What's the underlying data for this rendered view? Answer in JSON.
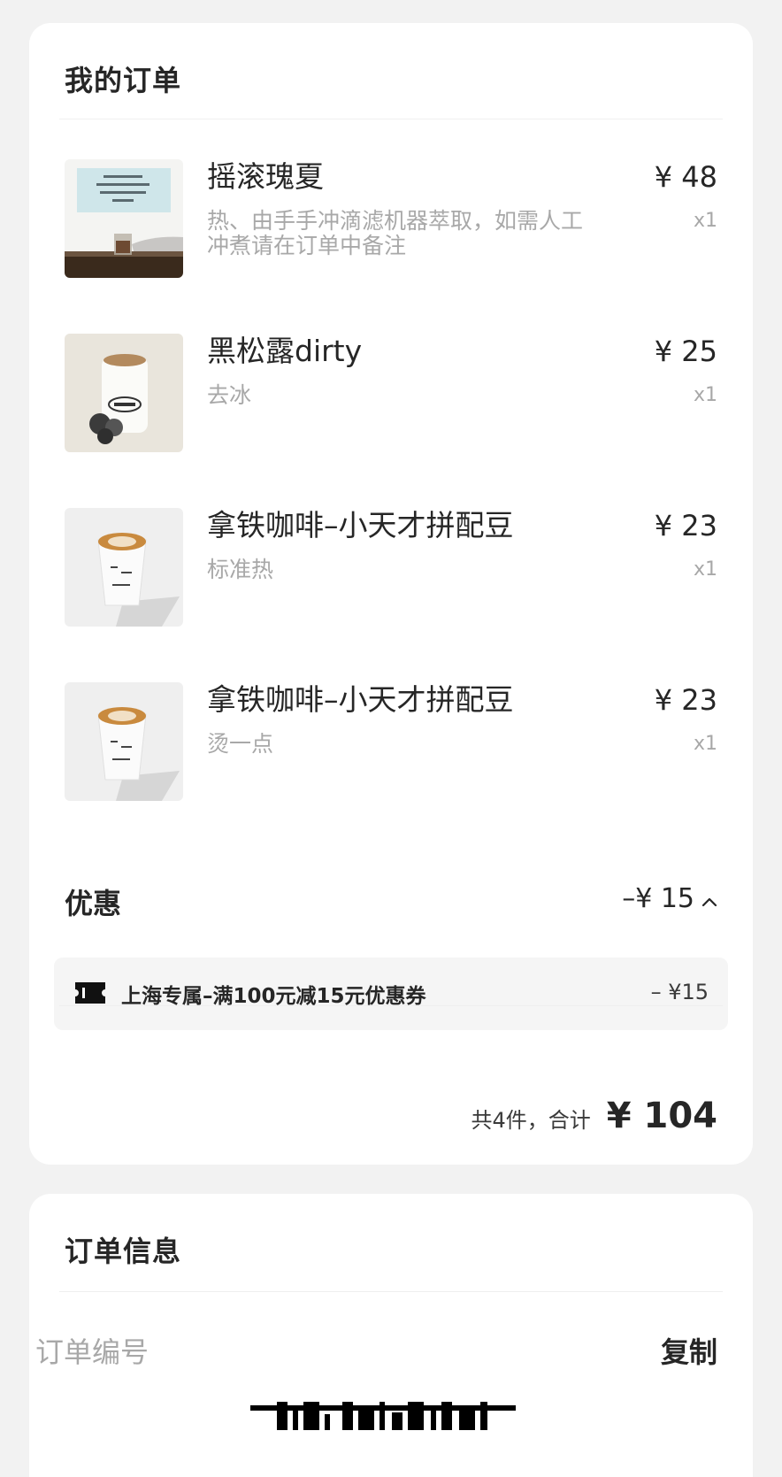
{
  "order": {
    "title": "我的订单",
    "items": [
      {
        "name": "摇滚瑰夏",
        "desc": "热、由手手冲滴滤机器萃取，如需人工冲煮请在订单中备注",
        "price": "¥ 48",
        "qty": "x1",
        "image": "paper-sign-coffee-photo"
      },
      {
        "name": "黑松露dirty",
        "desc": "去冰",
        "price": "¥ 25",
        "qty": "x1",
        "image": "pincle-can-truffle-photo"
      },
      {
        "name": "拿铁咖啡–小天才拼配豆",
        "desc": "标准热",
        "price": "¥ 23",
        "qty": "x1",
        "image": "latte-cup-photo"
      },
      {
        "name": "拿铁咖啡–小天才拼配豆",
        "desc": "烫一点",
        "price": "¥ 23",
        "qty": "x1",
        "image": "latte-cup-photo"
      }
    ],
    "promo": {
      "label": "优惠",
      "total": "–¥ 15",
      "coupon_name": "上海专属–满100元减15元优惠券",
      "coupon_amount": "– ¥15"
    },
    "summary": {
      "count_text": "共4件，合计",
      "total": "¥ 104"
    }
  },
  "info": {
    "title": "订单信息",
    "order_number_label": "订单编号",
    "copy_label": "复制"
  },
  "icons": {
    "promo_toggle": "chevron-up-icon",
    "coupon": "ticket-icon"
  },
  "colors": {
    "background": "#f2f2f2",
    "card": "#ffffff",
    "text": "#262626",
    "muted": "#a8a8a8",
    "coupon_bg": "#f5f5f5"
  }
}
